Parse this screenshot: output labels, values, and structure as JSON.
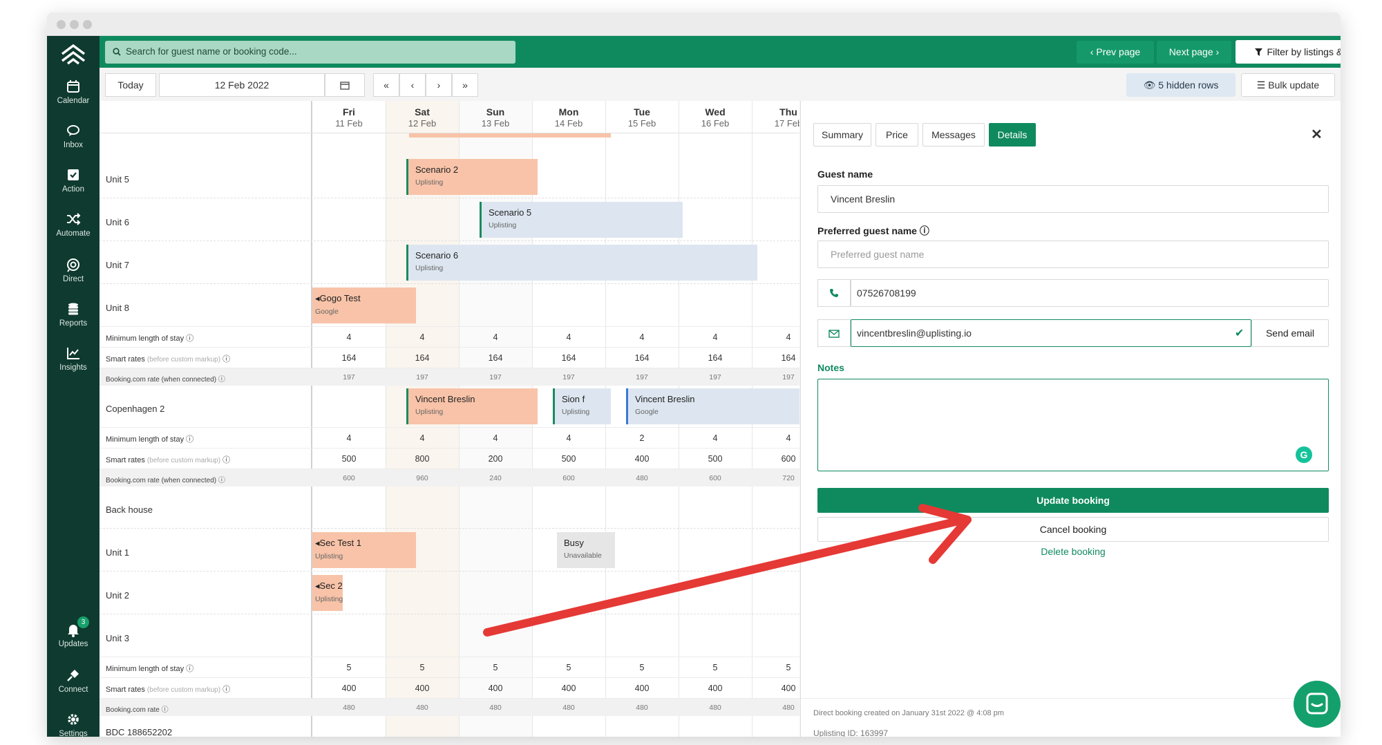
{
  "header": {
    "search_placeholder": "Search for guest name or booking code...",
    "prev_page": "Prev page",
    "next_page": "Next page",
    "filter": "Filter by listings & tags"
  },
  "sidebar": {
    "items": [
      {
        "label": "Calendar",
        "icon": "calendar-icon"
      },
      {
        "label": "Inbox",
        "icon": "chat-icon"
      },
      {
        "label": "Action",
        "icon": "checkbox-icon"
      },
      {
        "label": "Automate",
        "icon": "shuffle-icon"
      },
      {
        "label": "Direct",
        "icon": "direct-icon"
      },
      {
        "label": "Reports",
        "icon": "database-icon"
      },
      {
        "label": "Insights",
        "icon": "line-chart-icon"
      }
    ],
    "bottom": [
      {
        "label": "Updates",
        "icon": "bell-icon",
        "badge": "3"
      },
      {
        "label": "Connect",
        "icon": "plug-icon"
      },
      {
        "label": "Settings",
        "icon": "gear-icon"
      }
    ]
  },
  "controls": {
    "today": "Today",
    "date": "12 Feb 2022",
    "nav": [
      "«",
      "‹",
      "›",
      "»"
    ],
    "hidden_rows": "5 hidden rows",
    "bulk_update": "Bulk update"
  },
  "calendar": {
    "days": [
      {
        "name": "Fri",
        "date": "11 Feb"
      },
      {
        "name": "Sat",
        "date": "12 Feb"
      },
      {
        "name": "Sun",
        "date": "13 Feb"
      },
      {
        "name": "Mon",
        "date": "14 Feb"
      },
      {
        "name": "Tue",
        "date": "15 Feb"
      },
      {
        "name": "Wed",
        "date": "16 Feb"
      },
      {
        "name": "Thu",
        "date": "17 Feb"
      }
    ],
    "units": {
      "u5": "Unit 5",
      "u6": "Unit 6",
      "u7": "Unit 7",
      "u8": "Unit 8",
      "cph": "Copenhagen 2",
      "back": "Back house",
      "u1": "Unit 1",
      "u2": "Unit 2",
      "u3": "Unit 3",
      "bdc": "BDC 188652202"
    },
    "labels": {
      "min_stay": "Minimum length of stay",
      "smart_rates": "Smart rates",
      "smart_rates_note": "(before custom markup)",
      "booking_rate_wc": "Booking.com rate (when connected)",
      "booking_rate": "Booking.com rate"
    },
    "group1": {
      "min_stay": [
        "4",
        "4",
        "4",
        "4",
        "4",
        "4",
        "4"
      ],
      "smart": [
        "164",
        "164",
        "164",
        "164",
        "164",
        "164",
        "164"
      ],
      "booking": [
        "197",
        "197",
        "197",
        "197",
        "197",
        "197",
        "197"
      ]
    },
    "group2": {
      "min_stay": [
        "4",
        "4",
        "4",
        "4",
        "2",
        "4",
        "4"
      ],
      "smart": [
        "500",
        "800",
        "200",
        "500",
        "400",
        "500",
        "600"
      ],
      "booking": [
        "600",
        "960",
        "240",
        "600",
        "480",
        "600",
        "720"
      ]
    },
    "group3": {
      "min_stay": [
        "5",
        "5",
        "5",
        "5",
        "5",
        "5",
        "5"
      ],
      "smart": [
        "400",
        "400",
        "400",
        "400",
        "400",
        "400",
        "400"
      ],
      "booking": [
        "480",
        "480",
        "480",
        "480",
        "480",
        "480",
        "480"
      ]
    },
    "bookings": {
      "scn2": {
        "title": "Scenario 2",
        "source": "Uplisting"
      },
      "scn5": {
        "title": "Scenario 5",
        "source": "Uplisting"
      },
      "scn6": {
        "title": "Scenario 6",
        "source": "Uplisting"
      },
      "gogo": {
        "title": "Gogo Test",
        "source": "Google"
      },
      "vb1": {
        "title": "Vincent Breslin",
        "source": "Uplisting"
      },
      "sion": {
        "title": "Sion f",
        "source": "Uplisting"
      },
      "vb2": {
        "title": "Vincent Breslin",
        "source": "Google"
      },
      "sec1": {
        "title": "Sec Test 1",
        "source": "Uplisting"
      },
      "busy": {
        "title": "Busy",
        "source": "Unavailable"
      },
      "sec2": {
        "title": "Sec 2",
        "source": "Uplisting"
      }
    }
  },
  "panel": {
    "tabs": [
      "Summary",
      "Price",
      "Messages",
      "Details"
    ],
    "active_tab": "Details",
    "guest_name_label": "Guest name",
    "guest_name": "Vincent Breslin",
    "preferred_label": "Preferred guest name",
    "preferred_placeholder": "Preferred guest name",
    "phone": "07526708199",
    "email": "vincentbreslin@uplisting.io",
    "send_email": "Send email",
    "notes_label": "Notes",
    "update": "Update booking",
    "cancel": "Cancel booking",
    "delete": "Delete booking",
    "created": "Direct booking created on January 31st 2022 @ 4:08 pm",
    "uplisting_id": "Uplisting ID: 163997"
  },
  "colors": {
    "brand": "#0f8a5f",
    "sidebar": "#0f3a2f",
    "booking_orange": "#f8c3a8",
    "booking_blue": "#dde6f0",
    "arrow": "#e53935"
  }
}
